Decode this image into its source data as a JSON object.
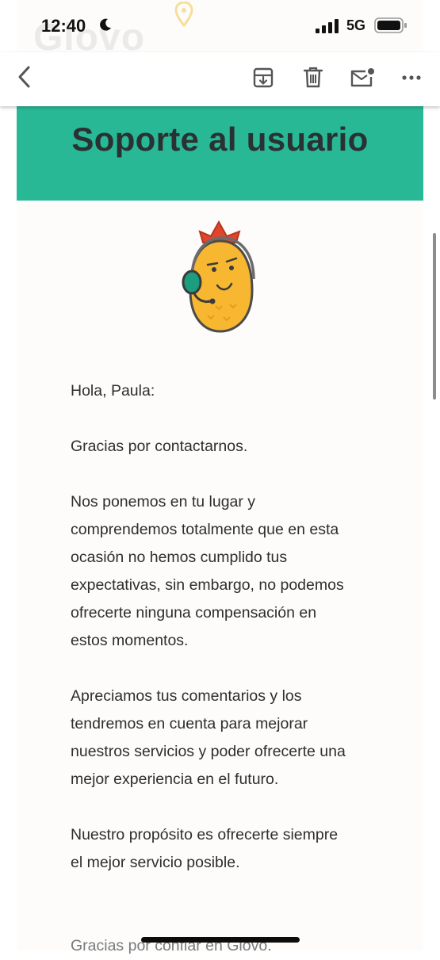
{
  "status_bar": {
    "time": "12:40",
    "network": "5G",
    "watermark": "Glovo"
  },
  "toolbar": {
    "back_icon": "chevron-left-icon",
    "archive_icon": "archive-icon",
    "trash_icon": "trash-icon",
    "mark_unread_icon": "mail-unread-icon",
    "more_icon": "more-horizontal-icon"
  },
  "email": {
    "banner_title": "Soporte al usuario",
    "banner_color": "#29b895",
    "greeting": "Hola, Paula:",
    "thanks": "Gracias por contactarnos.",
    "paragraph_1_lines": [
      "Nos ponemos en tu lugar y",
      "comprendemos totalmente que en esta",
      "ocasión no hemos cumplido tus",
      "expectativas, sin embargo, no podemos",
      "ofrecerte ninguna compensación en",
      "estos momentos."
    ],
    "paragraph_2_lines": [
      "Apreciamos tus comentarios y los",
      "tendremos en cuenta para mejorar",
      "nuestros servicios y poder ofrecerte una",
      "mejor experiencia en el futuro."
    ],
    "paragraph_3_lines": [
      "Nuestro propósito es ofrecerte siempre",
      "el mejor servicio posible."
    ],
    "signoff": "Gracias por confiar en Glovo."
  }
}
